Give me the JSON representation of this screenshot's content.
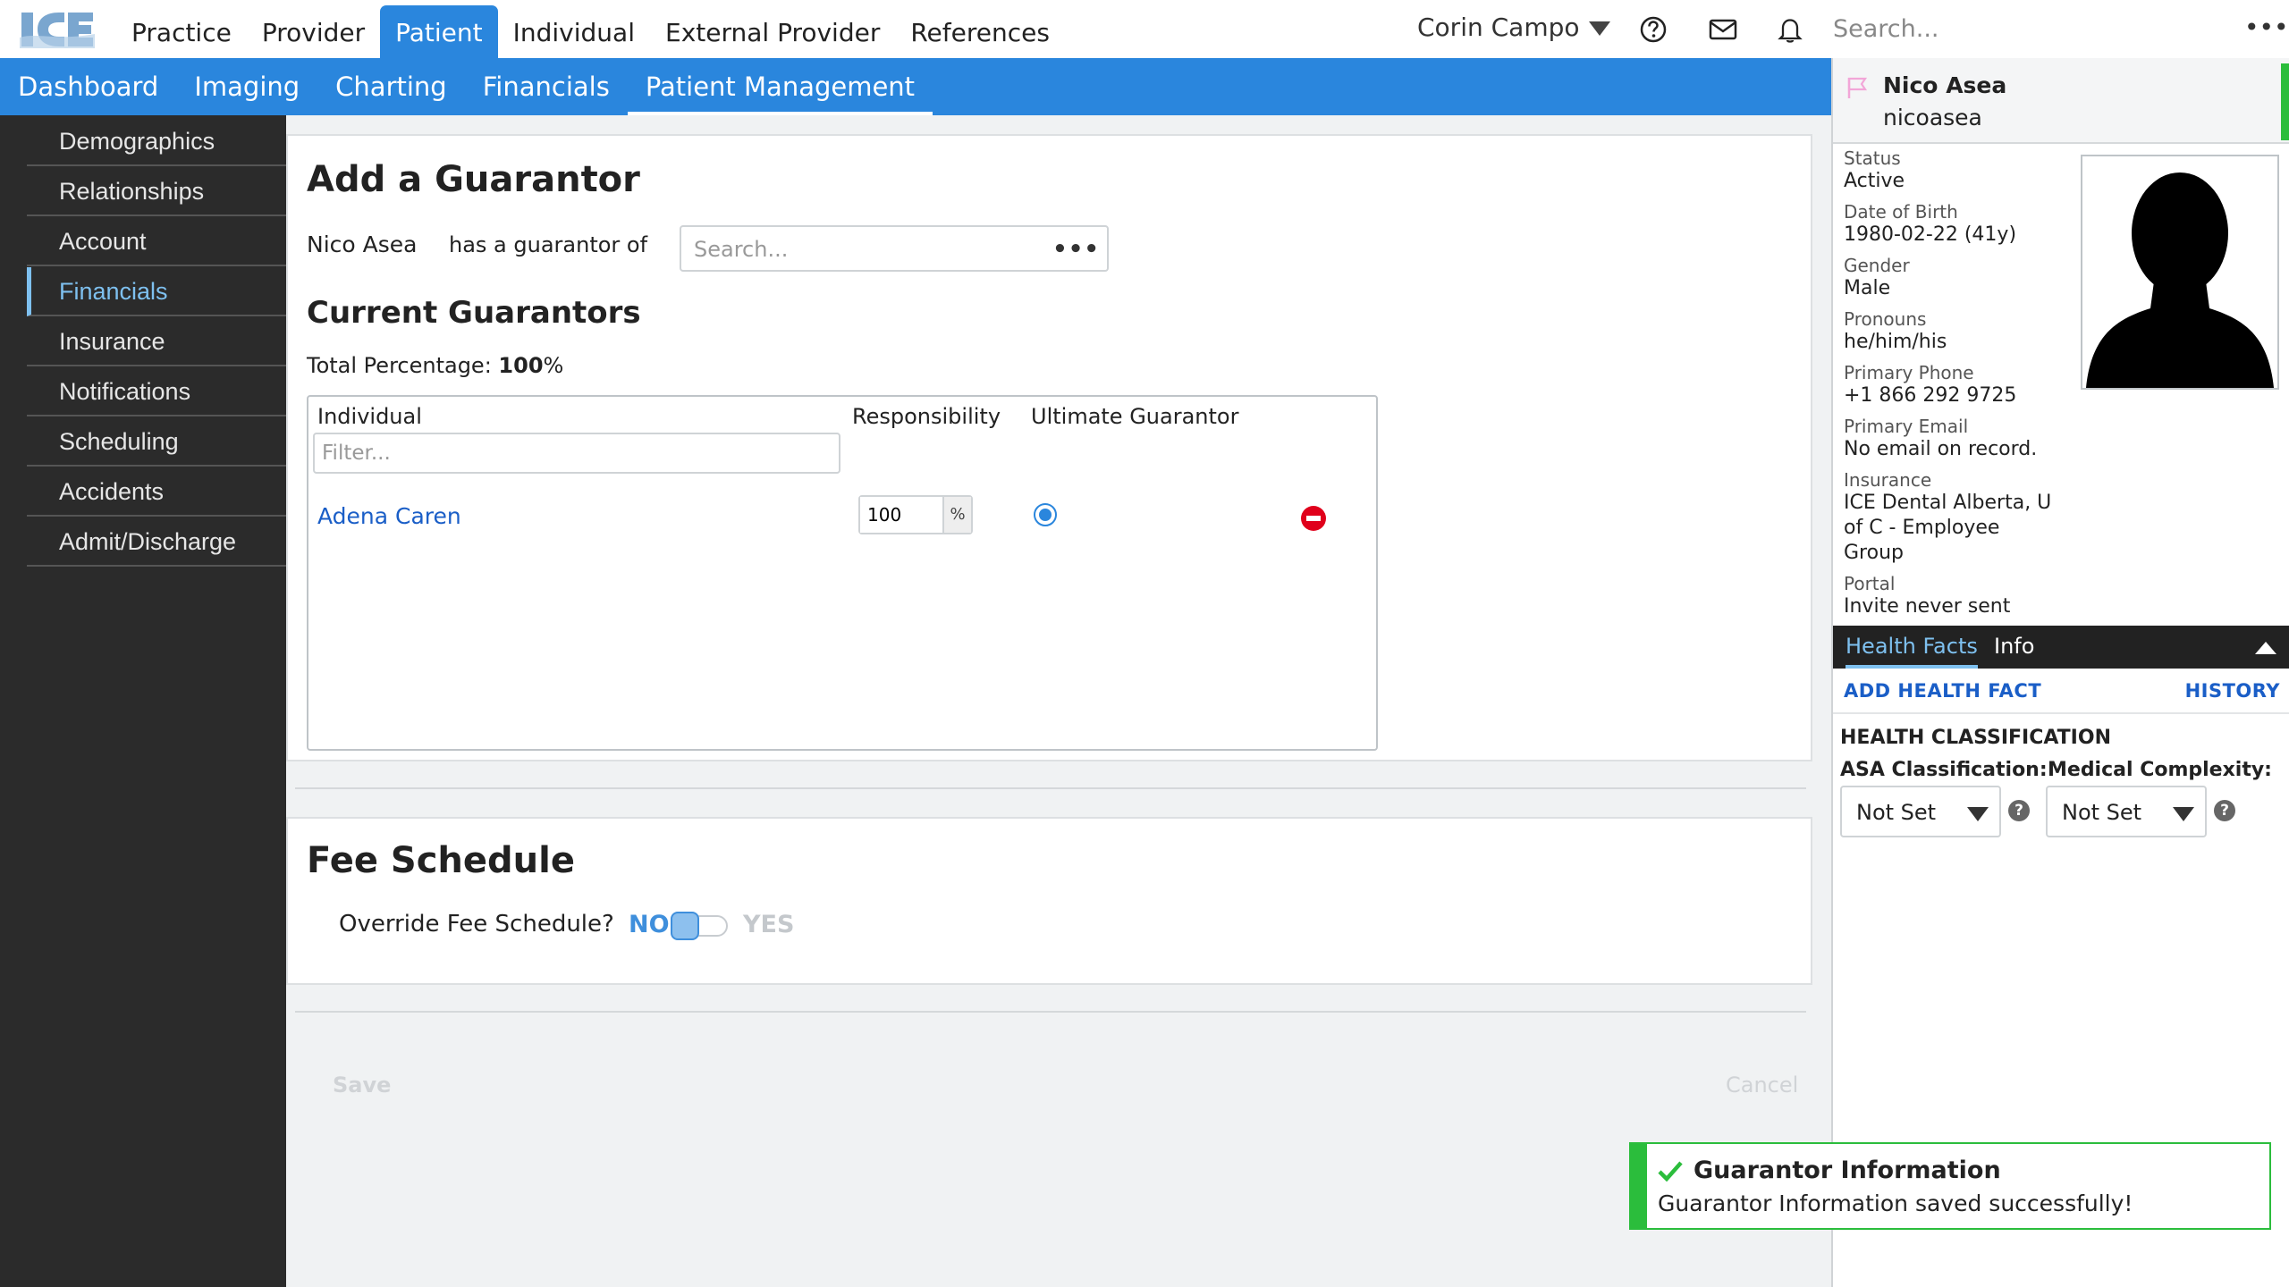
{
  "topnav": {
    "items": [
      "Practice",
      "Provider",
      "Patient",
      "Individual",
      "External Provider",
      "References"
    ],
    "active": "Patient",
    "user": "Corin Campo",
    "search_placeholder": "Search...",
    "more": "•••"
  },
  "subnav": {
    "items": [
      "Dashboard",
      "Imaging",
      "Charting",
      "Financials",
      "Patient Management"
    ],
    "active": "Patient Management"
  },
  "sidebar": {
    "items": [
      "Demographics",
      "Relationships",
      "Account",
      "Financials",
      "Insurance",
      "Notifications",
      "Scheduling",
      "Accidents",
      "Admit/Discharge"
    ],
    "active": "Financials"
  },
  "guarantor": {
    "title": "Add a Guarantor",
    "patient_name": "Nico Asea",
    "has_guarantor_text": "has a guarantor of",
    "search_placeholder": "Search...",
    "more": "•••",
    "current_title": "Current Guarantors",
    "total_label": "Total Percentage:",
    "total_value": "100",
    "total_unit": "%",
    "columns": [
      "Individual",
      "Responsibility",
      "Ultimate Guarantor"
    ],
    "filter_placeholder": "Filter...",
    "rows": [
      {
        "individual": "Adena Caren",
        "responsibility": "100",
        "unit": "%",
        "ultimate": true
      }
    ]
  },
  "fee_schedule": {
    "title": "Fee Schedule",
    "override_label": "Override Fee Schedule?",
    "no": "NO",
    "yes": "YES",
    "value": "NO"
  },
  "actions": {
    "save": "Save",
    "cancel": "Cancel"
  },
  "patient_panel": {
    "name": "Nico Asea",
    "username": "nicoasea",
    "fields": [
      {
        "label": "Status",
        "value": "Active"
      },
      {
        "label": "Date of Birth",
        "value": "1980-02-22 (41y)"
      },
      {
        "label": "Gender",
        "value": "Male"
      },
      {
        "label": "Pronouns",
        "value": "he/him/his"
      },
      {
        "label": "Primary Phone",
        "value": "+1 866 292 9725"
      },
      {
        "label": "Primary Email",
        "value": "No email on record."
      }
    ],
    "insurance_label": "Insurance",
    "insurance_lines": [
      "ICE Dental Alberta, U",
      "of C - Employee",
      "Group"
    ],
    "portal_label": "Portal",
    "portal_value": "Invite never sent",
    "tabs": [
      "Health Facts",
      "Info"
    ],
    "active_tab": "Health Facts",
    "add_health_fact": "ADD HEALTH FACT",
    "history": "HISTORY",
    "health_classification": "HEALTH CLASSIFICATION",
    "asa_label": "ASA Classification:",
    "asa_value": "Not Set",
    "complexity_label": "Medical Complexity:",
    "complexity_value": "Not Set"
  },
  "toast": {
    "title": "Guarantor Information",
    "message": "Guarantor Information saved successfully!"
  },
  "colors": {
    "primary": "#2a86dd",
    "sidebar": "#2b2b2b",
    "success": "#2bbd3c",
    "danger": "#e0001b",
    "link": "#1a5ec7"
  }
}
